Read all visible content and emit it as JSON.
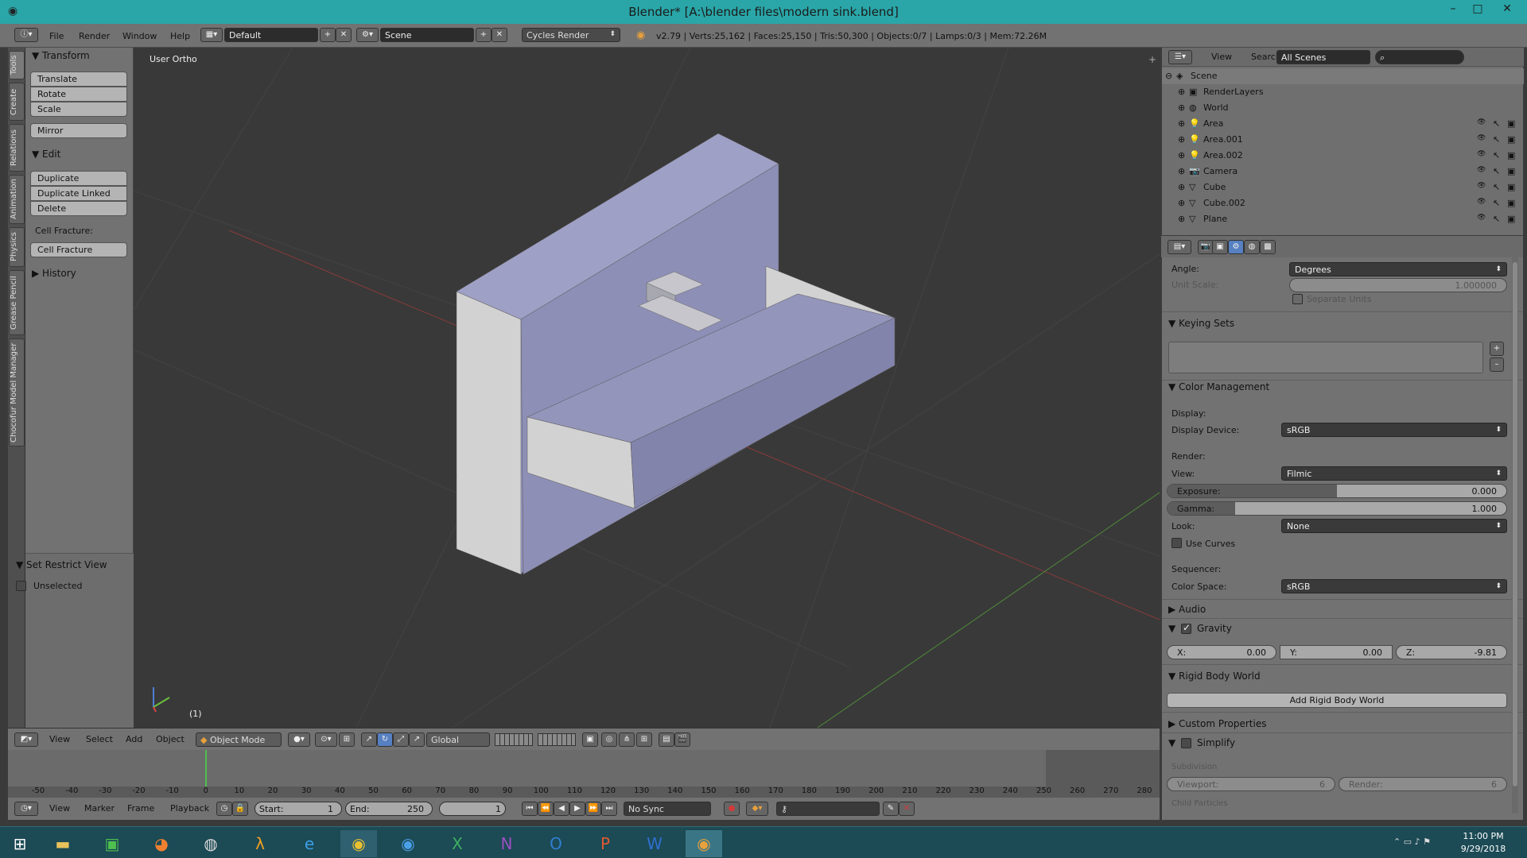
{
  "window": {
    "title": "Blender* [A:\\blender files\\modern sink.blend]",
    "min_label": "–",
    "max_label": "□",
    "close_label": "✕"
  },
  "infobar": {
    "menus": [
      "File",
      "Render",
      "Window",
      "Help"
    ],
    "layout": "Default",
    "scene": "Scene",
    "engine": "Cycles Render",
    "stats": "v2.79 | Verts:25,162 | Faces:25,150 | Tris:50,300 | Objects:0/7 | Lamps:0/3 | Mem:72.26M"
  },
  "left_tabs": [
    "Tools",
    "Create",
    "Relations",
    "Animation",
    "Physics",
    "Grease Pencil",
    "Chocofur Model Manager"
  ],
  "toolshelf": {
    "transform_header": "Transform",
    "translate": "Translate",
    "rotate": "Rotate",
    "scale": "Scale",
    "mirror": "Mirror",
    "edit_header": "Edit",
    "duplicate": "Duplicate",
    "duplicate_linked": "Duplicate Linked",
    "delete": "Delete",
    "cell_fracture_label": "Cell Fracture:",
    "cell_fracture_btn": "Cell Fracture",
    "history_header": "History",
    "restrict_header": "Set Restrict View",
    "unselected": "Unselected"
  },
  "viewport": {
    "view_label": "User Ortho",
    "frame_label": "(1)"
  },
  "viewport_header": {
    "menus": [
      "View",
      "Select",
      "Add",
      "Object"
    ],
    "mode": "Object Mode",
    "orientation": "Global"
  },
  "timeline": {
    "ticks": [
      "-50",
      "-40",
      "-30",
      "-20",
      "-10",
      "0",
      "10",
      "20",
      "30",
      "40",
      "50",
      "60",
      "70",
      "80",
      "90",
      "100",
      "110",
      "120",
      "130",
      "140",
      "150",
      "160",
      "170",
      "180",
      "190",
      "200",
      "210",
      "220",
      "230",
      "240",
      "250",
      "260",
      "270",
      "280"
    ],
    "menus": [
      "View",
      "Marker",
      "Frame",
      "Playback"
    ],
    "start_label": "Start:",
    "start_value": "1",
    "end_label": "End:",
    "end_value": "250",
    "current": "1",
    "sync": "No Sync"
  },
  "outliner": {
    "view": "View",
    "search": "Search",
    "scenes": "All Scenes",
    "items": [
      {
        "name": "Scene"
      },
      {
        "name": "RenderLayers"
      },
      {
        "name": "World"
      },
      {
        "name": "Area"
      },
      {
        "name": "Area.001"
      },
      {
        "name": "Area.002"
      },
      {
        "name": "Camera"
      },
      {
        "name": "Cube"
      },
      {
        "name": "Cube.002"
      },
      {
        "name": "Plane"
      }
    ]
  },
  "props": {
    "angle_label": "Angle:",
    "angle_value": "Degrees",
    "unit_scale_label": "Unit Scale:",
    "unit_scale_value": "1.000000",
    "separate_units": "Separate Units",
    "keying_sets": "Keying Sets",
    "color_management": "Color Management",
    "display_label": "Display:",
    "display_device_label": "Display Device:",
    "display_device_value": "sRGB",
    "render_label": "Render:",
    "view_label": "View:",
    "view_value": "Filmic",
    "exposure_label": "Exposure:",
    "exposure_value": "0.000",
    "exposure_fraction": 0.5,
    "gamma_label": "Gamma:",
    "gamma_value": "1.000",
    "gamma_fraction": 0.2,
    "look_label": "Look:",
    "look_value": "None",
    "use_curves": "Use Curves",
    "sequencer_label": "Sequencer:",
    "color_space_label": "Color Space:",
    "color_space_value": "sRGB",
    "audio": "Audio",
    "gravity": "Gravity",
    "gx_label": "X:",
    "gx_value": "0.00",
    "gy_label": "Y:",
    "gy_value": "0.00",
    "gz_label": "Z:",
    "gz_value": "-9.81",
    "rigid_body_world": "Rigid Body World",
    "add_rigid_body_world": "Add Rigid Body World",
    "custom_properties": "Custom Properties",
    "simplify": "Simplify",
    "subdivision": "Subdivision",
    "viewport_label": "Viewport:",
    "viewport_value": "6",
    "render_sub_label": "Render:",
    "render_sub_value": "6",
    "child_particles": "Child Particles"
  },
  "taskbar": {
    "time": "11:00 PM",
    "date": "9/29/2018"
  },
  "colors": {
    "titlebar": "#2aa6a8",
    "viewport_bg": "#393939",
    "panel": "#727272",
    "mesh": "#9c9cbc",
    "taskbar": "#1c4a55"
  }
}
